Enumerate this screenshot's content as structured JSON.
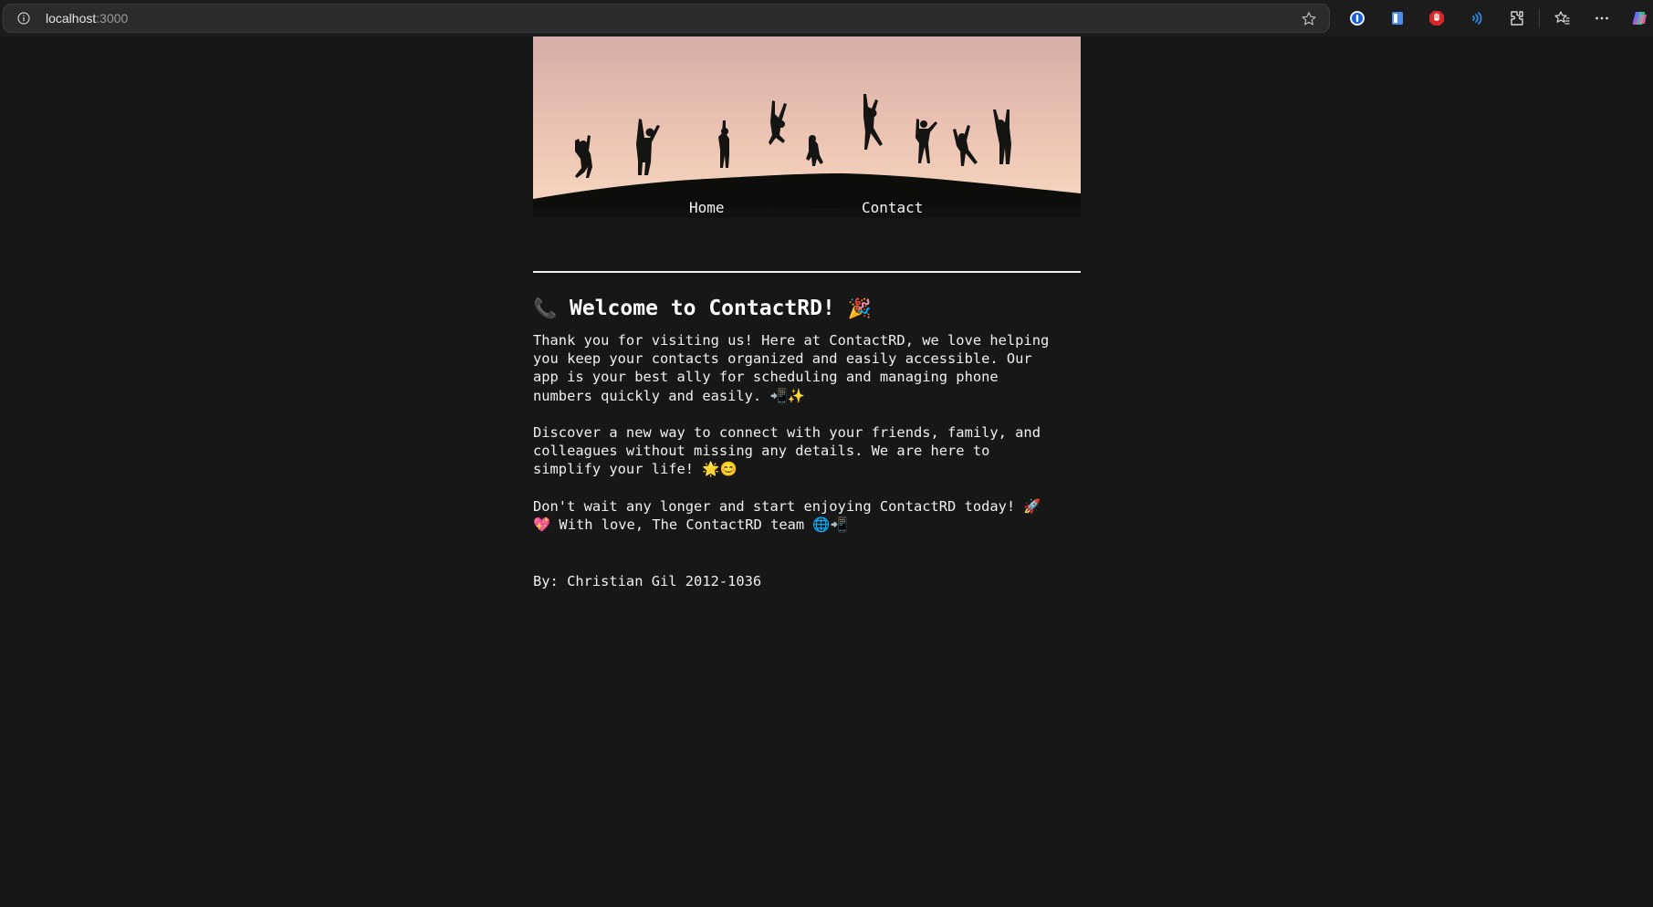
{
  "browser": {
    "url_host": "localhost",
    "url_port": ":3000",
    "icons": [
      "info-icon",
      "star-icon",
      "password-manager-icon",
      "reading-list-icon",
      "adblock-icon",
      "read-aloud-icon",
      "extensions-icon",
      "favorites-icon",
      "more-icon",
      "copilot-icon"
    ]
  },
  "hero": {
    "image": "silhouettes of people jumping on a hill at sunset"
  },
  "nav": {
    "home_label": "Home",
    "contact_label": "Contact"
  },
  "welcome": {
    "title_emoji_left": "📞",
    "title_text": "Welcome to ContactRD!",
    "title_emoji_right": "🎉",
    "paragraph1": [
      "Thank you for visiting us! Here at ContactRD, we love helping",
      "you keep your contacts organized and easily accessible. Our",
      "app is your best ally for scheduling and managing phone",
      "numbers quickly and easily. 📲✨"
    ],
    "paragraph2": [
      "Discover a new way to connect with your friends, family, and",
      "colleagues without missing any details. We are here to",
      "simplify your life! 🌟😊"
    ],
    "paragraph3": [
      "Don't wait any longer and start enjoying ContactRD today! 🚀",
      "💖 With love, The ContactRD team 🌐📲"
    ]
  },
  "footer": {
    "byline": "By: Christian Gil 2012-1036"
  },
  "colors": {
    "background": "#171717",
    "text": "#f0f0f0",
    "sky_top": "#d9b0a6",
    "sky_bottom": "#f3cdb5"
  }
}
